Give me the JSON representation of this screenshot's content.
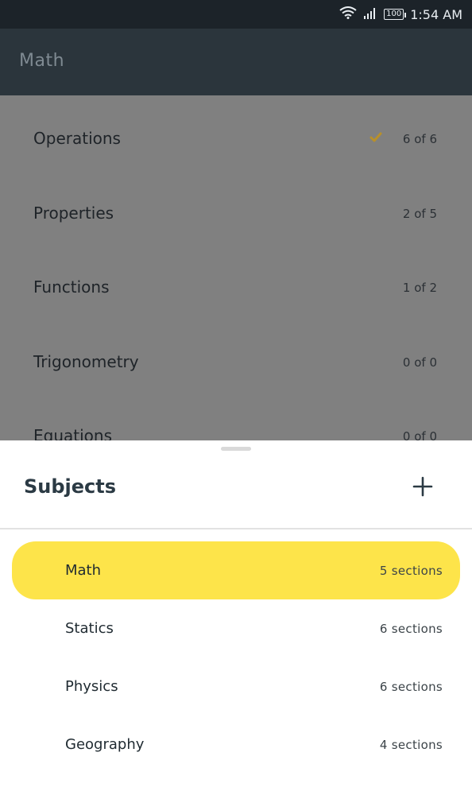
{
  "status_bar": {
    "time": "1:54 AM",
    "battery": "100",
    "icons": [
      "wifi-icon",
      "signal-icon",
      "battery-icon"
    ]
  },
  "app_bar": {
    "title": "Math"
  },
  "sections": [
    {
      "name": "Operations",
      "count": "6 of 6",
      "completed": true
    },
    {
      "name": "Properties",
      "count": "2 of 5",
      "completed": false
    },
    {
      "name": "Functions",
      "count": "1 of 2",
      "completed": false
    },
    {
      "name": "Trigonometry",
      "count": "0 of 0",
      "completed": false
    },
    {
      "name": "Equations",
      "count": "0 of 0",
      "completed": false
    }
  ],
  "sheet": {
    "title": "Subjects",
    "add_icon": "plus-icon",
    "subjects": [
      {
        "name": "Math",
        "count": "5 sections",
        "selected": true
      },
      {
        "name": "Statics",
        "count": "6 sections",
        "selected": false
      },
      {
        "name": "Physics",
        "count": "6 sections",
        "selected": false
      },
      {
        "name": "Geography",
        "count": "4 sections",
        "selected": false
      }
    ]
  },
  "colors": {
    "accent": "#fde44a",
    "check": "#b8902a",
    "app_bar": "#2b353c",
    "scrim": "#808080"
  }
}
